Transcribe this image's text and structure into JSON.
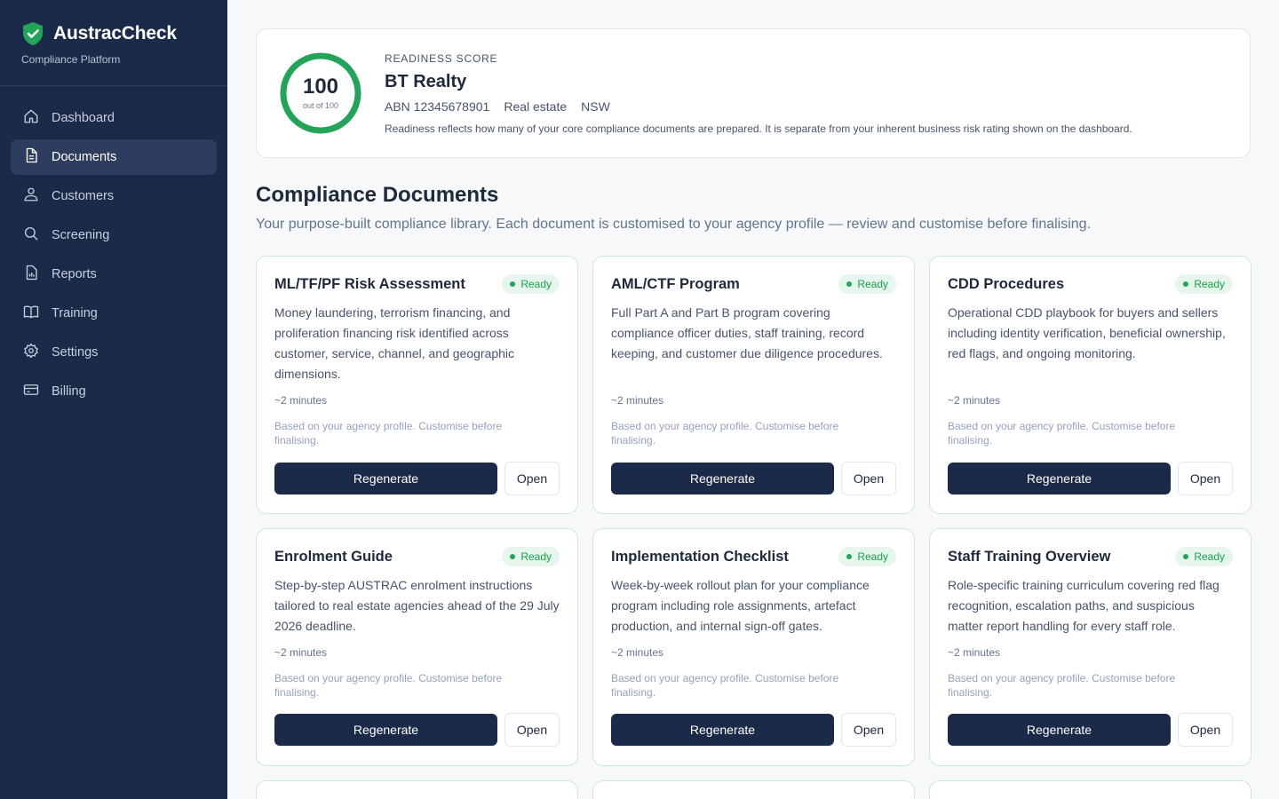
{
  "app": {
    "name": "AustracCheck",
    "subtitle": "Compliance Platform",
    "accent": "#22a559",
    "sidebar_bg": "#1c2a4a"
  },
  "sidebar": {
    "items": [
      {
        "label": "Dashboard",
        "icon": "home-icon",
        "active": false
      },
      {
        "label": "Documents",
        "icon": "document-icon",
        "active": true
      },
      {
        "label": "Customers",
        "icon": "users-icon",
        "active": false
      },
      {
        "label": "Screening",
        "icon": "search-icon",
        "active": false
      },
      {
        "label": "Reports",
        "icon": "report-icon",
        "active": false
      },
      {
        "label": "Training",
        "icon": "book-icon",
        "active": false
      },
      {
        "label": "Settings",
        "icon": "gear-icon",
        "active": false
      },
      {
        "label": "Billing",
        "icon": "credit-card-icon",
        "active": false
      }
    ]
  },
  "readiness": {
    "label": "READINESS SCORE",
    "score": "100",
    "score_caption": "out of 100",
    "score_fraction": 1.0,
    "business_name": "BT Realty",
    "abn": "ABN 12345678901",
    "industry": "Real estate",
    "state": "NSW",
    "note": "Readiness reflects how many of your core compliance documents are prepared. It is separate from your inherent business risk rating shown on the dashboard."
  },
  "section": {
    "title": "Compliance Documents",
    "subtitle": "Your purpose-built compliance library. Each document is customised to your agency profile — review and customise before finalising."
  },
  "documents": [
    {
      "title": "ML/TF/PF Risk Assessment",
      "status": "Ready",
      "description": "Money laundering, terrorism financing, and proliferation financing risk identified across customer, service, channel, and geographic dimensions.",
      "time": "~2 minutes",
      "note": "Based on your agency profile. Customise before finalising.",
      "primary": "Regenerate",
      "secondary": "Open"
    },
    {
      "title": "AML/CTF Program",
      "status": "Ready",
      "description": "Full Part A and Part B program covering compliance officer duties, staff training, record keeping, and customer due diligence procedures.",
      "time": "~2 minutes",
      "note": "Based on your agency profile. Customise before finalising.",
      "primary": "Regenerate",
      "secondary": "Open"
    },
    {
      "title": "CDD Procedures",
      "status": "Ready",
      "description": "Operational CDD playbook for buyers and sellers including identity verification, beneficial ownership, red flags, and ongoing monitoring.",
      "time": "~2 minutes",
      "note": "Based on your agency profile. Customise before finalising.",
      "primary": "Regenerate",
      "secondary": "Open"
    },
    {
      "title": "Enrolment Guide",
      "status": "Ready",
      "description": "Step-by-step AUSTRAC enrolment instructions tailored to real estate agencies ahead of the 29 July 2026 deadline.",
      "time": "~2 minutes",
      "note": "Based on your agency profile. Customise before finalising.",
      "primary": "Regenerate",
      "secondary": "Open"
    },
    {
      "title": "Implementation Checklist",
      "status": "Ready",
      "description": "Week-by-week rollout plan for your compliance program including role assignments, artefact production, and internal sign-off gates.",
      "time": "~2 minutes",
      "note": "Based on your agency profile. Customise before finalising.",
      "primary": "Regenerate",
      "secondary": "Open"
    },
    {
      "title": "Staff Training Overview",
      "status": "Ready",
      "description": "Role-specific training curriculum covering red flag recognition, escalation paths, and suspicious matter report handling for every staff role.",
      "time": "~2 minutes",
      "note": "Based on your agency profile. Customise before finalising.",
      "primary": "Regenerate",
      "secondary": "Open"
    }
  ]
}
